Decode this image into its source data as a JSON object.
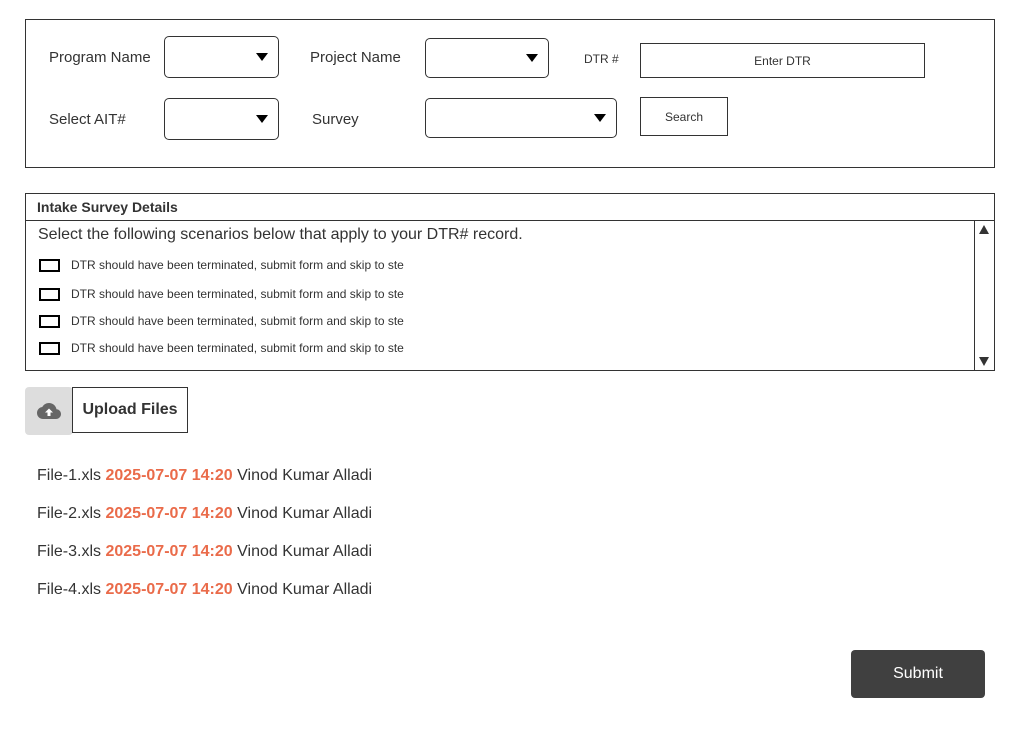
{
  "filters": {
    "program_name_label": "Program Name",
    "project_name_label": "Project Name",
    "dtr_label": "DTR #",
    "dtr_placeholder": "Enter DTR",
    "select_ait_label": "Select AIT#",
    "survey_label": "Survey",
    "search_label": "Search"
  },
  "survey": {
    "title": "Intake Survey Details",
    "instruction": "Select the following scenarios below that apply to your DTR# record.",
    "options": [
      "DTR should have been terminated, submit form and skip to ste",
      "DTR should have been terminated, submit form and skip to ste",
      "DTR should have been terminated, submit form and skip to ste",
      "DTR should have been terminated, submit form and skip to ste"
    ]
  },
  "upload": {
    "icon": "cloud-upload-icon",
    "label": "Upload Files"
  },
  "files": [
    {
      "name": "File-1.xls",
      "timestamp": "2025-07-07 14:20",
      "user": "Vinod Kumar Alladi"
    },
    {
      "name": "File-2.xls",
      "timestamp": "2025-07-07 14:20",
      "user": "Vinod Kumar Alladi"
    },
    {
      "name": "File-3.xls",
      "timestamp": "2025-07-07 14:20",
      "user": "Vinod Kumar Alladi"
    },
    {
      "name": "File-4.xls",
      "timestamp": "2025-07-07 14:20",
      "user": "Vinod Kumar Alladi"
    }
  ],
  "submit_label": "Submit",
  "colors": {
    "timestamp": "#ea6b4a",
    "submit_bg": "#404040",
    "upload_icon_bg": "#dddddd"
  }
}
